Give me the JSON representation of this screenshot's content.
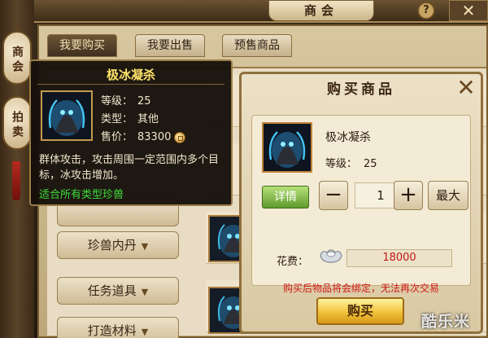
{
  "header": {
    "title": "商会",
    "help_label": "?",
    "close_label": "✕"
  },
  "side_tabs": [
    {
      "label": "商会"
    },
    {
      "label": "拍卖"
    }
  ],
  "tabs": [
    {
      "label": "我要购买",
      "active": true
    },
    {
      "label": "我要出售",
      "active": false
    },
    {
      "label": "预售商品",
      "active": false
    }
  ],
  "categories": [
    {
      "label": ""
    },
    {
      "label": "珍兽内丹"
    },
    {
      "label": "任务道具"
    },
    {
      "label": "打造材料"
    }
  ],
  "tooltip": {
    "title": "极冰凝杀",
    "level_label": "等级：",
    "level_value": "25",
    "type_label": "类型：",
    "type_value": "其他",
    "price_label": "售价：",
    "price_value": "83300",
    "description": "群体攻击，攻击周围一定范围内多个目标，冰攻击增加。",
    "suitable": "适合所有类型珍兽"
  },
  "dialog": {
    "title": "购买商品",
    "close_label": "✕",
    "top_notice": "",
    "item_name": "极冰凝杀",
    "level_label": "等级：",
    "level_value": "25",
    "detail_button": "详情",
    "minus_label": "−",
    "quantity": "1",
    "plus_label": "+",
    "max_button": "最大",
    "cost_label": "花费：",
    "cost_value": "18000",
    "bind_warning": "购买后物品将会绑定，无法再次交易",
    "buy_button": "购买"
  },
  "watermark": "酷乐米",
  "colors": {
    "tooltip_title": "#ffe36a",
    "suitable_text": "#3fdc3a",
    "warning_text": "#d01b15",
    "cost_text": "#c01818"
  }
}
